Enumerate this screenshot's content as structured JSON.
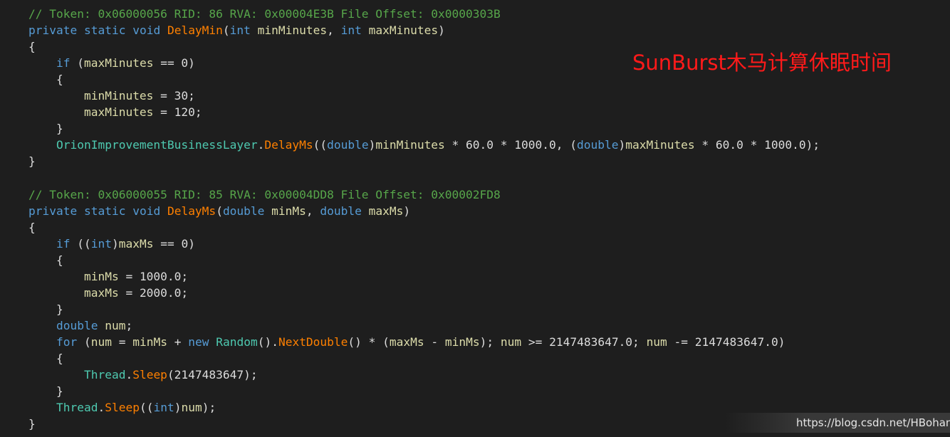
{
  "annotation": "SunBurst木马计算休眠时间",
  "watermark": "https://blog.csdn.net/HBohan",
  "colors": {
    "background": "#1e1e1e",
    "comment": "#57a64a",
    "keyword": "#569cd6",
    "method": "#ff8000",
    "type": "#4ec9b0",
    "variable": "#dcdcaa",
    "plain": "#dcdcdc",
    "annotation": "#ff1a1a"
  },
  "code": {
    "lines": [
      [
        {
          "t": "// Token: 0x06000056 RID: 86 RVA: 0x00004E3B File Offset: 0x0000303B",
          "c": "comment"
        }
      ],
      [
        {
          "t": "private",
          "c": "kw"
        },
        {
          "t": " ",
          "c": "plain"
        },
        {
          "t": "static",
          "c": "kw"
        },
        {
          "t": " ",
          "c": "plain"
        },
        {
          "t": "void",
          "c": "kw"
        },
        {
          "t": " ",
          "c": "plain"
        },
        {
          "t": "DelayMin",
          "c": "method"
        },
        {
          "t": "(",
          "c": "punct"
        },
        {
          "t": "int",
          "c": "kw"
        },
        {
          "t": " ",
          "c": "plain"
        },
        {
          "t": "minMinutes",
          "c": "var"
        },
        {
          "t": ", ",
          "c": "punct"
        },
        {
          "t": "int",
          "c": "kw"
        },
        {
          "t": " ",
          "c": "plain"
        },
        {
          "t": "maxMinutes",
          "c": "var"
        },
        {
          "t": ")",
          "c": "punct"
        }
      ],
      [
        {
          "t": "{",
          "c": "punct"
        }
      ],
      [
        {
          "t": "    ",
          "c": "plain"
        },
        {
          "t": "if",
          "c": "kw"
        },
        {
          "t": " (",
          "c": "punct"
        },
        {
          "t": "maxMinutes",
          "c": "var"
        },
        {
          "t": " == 0)",
          "c": "punct"
        }
      ],
      [
        {
          "t": "    {",
          "c": "punct"
        }
      ],
      [
        {
          "t": "        ",
          "c": "plain"
        },
        {
          "t": "minMinutes",
          "c": "var"
        },
        {
          "t": " = 30;",
          "c": "punct"
        }
      ],
      [
        {
          "t": "        ",
          "c": "plain"
        },
        {
          "t": "maxMinutes",
          "c": "var"
        },
        {
          "t": " = 120;",
          "c": "punct"
        }
      ],
      [
        {
          "t": "    }",
          "c": "punct"
        }
      ],
      [
        {
          "t": "    ",
          "c": "plain"
        },
        {
          "t": "OrionImprovementBusinessLayer",
          "c": "type"
        },
        {
          "t": ".",
          "c": "punct"
        },
        {
          "t": "DelayMs",
          "c": "method"
        },
        {
          "t": "((",
          "c": "punct"
        },
        {
          "t": "double",
          "c": "kw"
        },
        {
          "t": ")",
          "c": "punct"
        },
        {
          "t": "minMinutes",
          "c": "var"
        },
        {
          "t": " * 60.0 * 1000.0, (",
          "c": "punct"
        },
        {
          "t": "double",
          "c": "kw"
        },
        {
          "t": ")",
          "c": "punct"
        },
        {
          "t": "maxMinutes",
          "c": "var"
        },
        {
          "t": " * 60.0 * 1000.0);",
          "c": "punct"
        }
      ],
      [
        {
          "t": "}",
          "c": "punct"
        }
      ],
      [],
      [
        {
          "t": "// Token: 0x06000055 RID: 85 RVA: 0x00004DD8 File Offset: 0x00002FD8",
          "c": "comment"
        }
      ],
      [
        {
          "t": "private",
          "c": "kw"
        },
        {
          "t": " ",
          "c": "plain"
        },
        {
          "t": "static",
          "c": "kw"
        },
        {
          "t": " ",
          "c": "plain"
        },
        {
          "t": "void",
          "c": "kw"
        },
        {
          "t": " ",
          "c": "plain"
        },
        {
          "t": "DelayMs",
          "c": "method"
        },
        {
          "t": "(",
          "c": "punct"
        },
        {
          "t": "double",
          "c": "kw"
        },
        {
          "t": " ",
          "c": "plain"
        },
        {
          "t": "minMs",
          "c": "var"
        },
        {
          "t": ", ",
          "c": "punct"
        },
        {
          "t": "double",
          "c": "kw"
        },
        {
          "t": " ",
          "c": "plain"
        },
        {
          "t": "maxMs",
          "c": "var"
        },
        {
          "t": ")",
          "c": "punct"
        }
      ],
      [
        {
          "t": "{",
          "c": "punct"
        }
      ],
      [
        {
          "t": "    ",
          "c": "plain"
        },
        {
          "t": "if",
          "c": "kw"
        },
        {
          "t": " ((",
          "c": "punct"
        },
        {
          "t": "int",
          "c": "kw"
        },
        {
          "t": ")",
          "c": "punct"
        },
        {
          "t": "maxMs",
          "c": "var"
        },
        {
          "t": " == 0)",
          "c": "punct"
        }
      ],
      [
        {
          "t": "    {",
          "c": "punct"
        }
      ],
      [
        {
          "t": "        ",
          "c": "plain"
        },
        {
          "t": "minMs",
          "c": "var"
        },
        {
          "t": " = 1000.0;",
          "c": "punct"
        }
      ],
      [
        {
          "t": "        ",
          "c": "plain"
        },
        {
          "t": "maxMs",
          "c": "var"
        },
        {
          "t": " = 2000.0;",
          "c": "punct"
        }
      ],
      [
        {
          "t": "    }",
          "c": "punct"
        }
      ],
      [
        {
          "t": "    ",
          "c": "plain"
        },
        {
          "t": "double",
          "c": "kw"
        },
        {
          "t": " ",
          "c": "plain"
        },
        {
          "t": "num",
          "c": "var"
        },
        {
          "t": ";",
          "c": "punct"
        }
      ],
      [
        {
          "t": "    ",
          "c": "plain"
        },
        {
          "t": "for",
          "c": "kw"
        },
        {
          "t": " (",
          "c": "punct"
        },
        {
          "t": "num",
          "c": "var"
        },
        {
          "t": " = ",
          "c": "punct"
        },
        {
          "t": "minMs",
          "c": "var"
        },
        {
          "t": " + ",
          "c": "punct"
        },
        {
          "t": "new",
          "c": "kw"
        },
        {
          "t": " ",
          "c": "plain"
        },
        {
          "t": "Random",
          "c": "type"
        },
        {
          "t": "().",
          "c": "punct"
        },
        {
          "t": "NextDouble",
          "c": "method"
        },
        {
          "t": "() * (",
          "c": "punct"
        },
        {
          "t": "maxMs",
          "c": "var"
        },
        {
          "t": " - ",
          "c": "punct"
        },
        {
          "t": "minMs",
          "c": "var"
        },
        {
          "t": "); ",
          "c": "punct"
        },
        {
          "t": "num",
          "c": "var"
        },
        {
          "t": " >= 2147483647.0; ",
          "c": "punct"
        },
        {
          "t": "num",
          "c": "var"
        },
        {
          "t": " -= 2147483647.0)",
          "c": "punct"
        }
      ],
      [
        {
          "t": "    {",
          "c": "punct"
        }
      ],
      [
        {
          "t": "        ",
          "c": "plain"
        },
        {
          "t": "Thread",
          "c": "type"
        },
        {
          "t": ".",
          "c": "punct"
        },
        {
          "t": "Sleep",
          "c": "method"
        },
        {
          "t": "(2147483647);",
          "c": "punct"
        }
      ],
      [
        {
          "t": "    }",
          "c": "punct"
        }
      ],
      [
        {
          "t": "    ",
          "c": "plain"
        },
        {
          "t": "Thread",
          "c": "type"
        },
        {
          "t": ".",
          "c": "punct"
        },
        {
          "t": "Sleep",
          "c": "method"
        },
        {
          "t": "((",
          "c": "punct"
        },
        {
          "t": "int",
          "c": "kw"
        },
        {
          "t": ")",
          "c": "punct"
        },
        {
          "t": "num",
          "c": "var"
        },
        {
          "t": ");",
          "c": "punct"
        }
      ],
      [
        {
          "t": "}",
          "c": "punct"
        }
      ]
    ]
  }
}
